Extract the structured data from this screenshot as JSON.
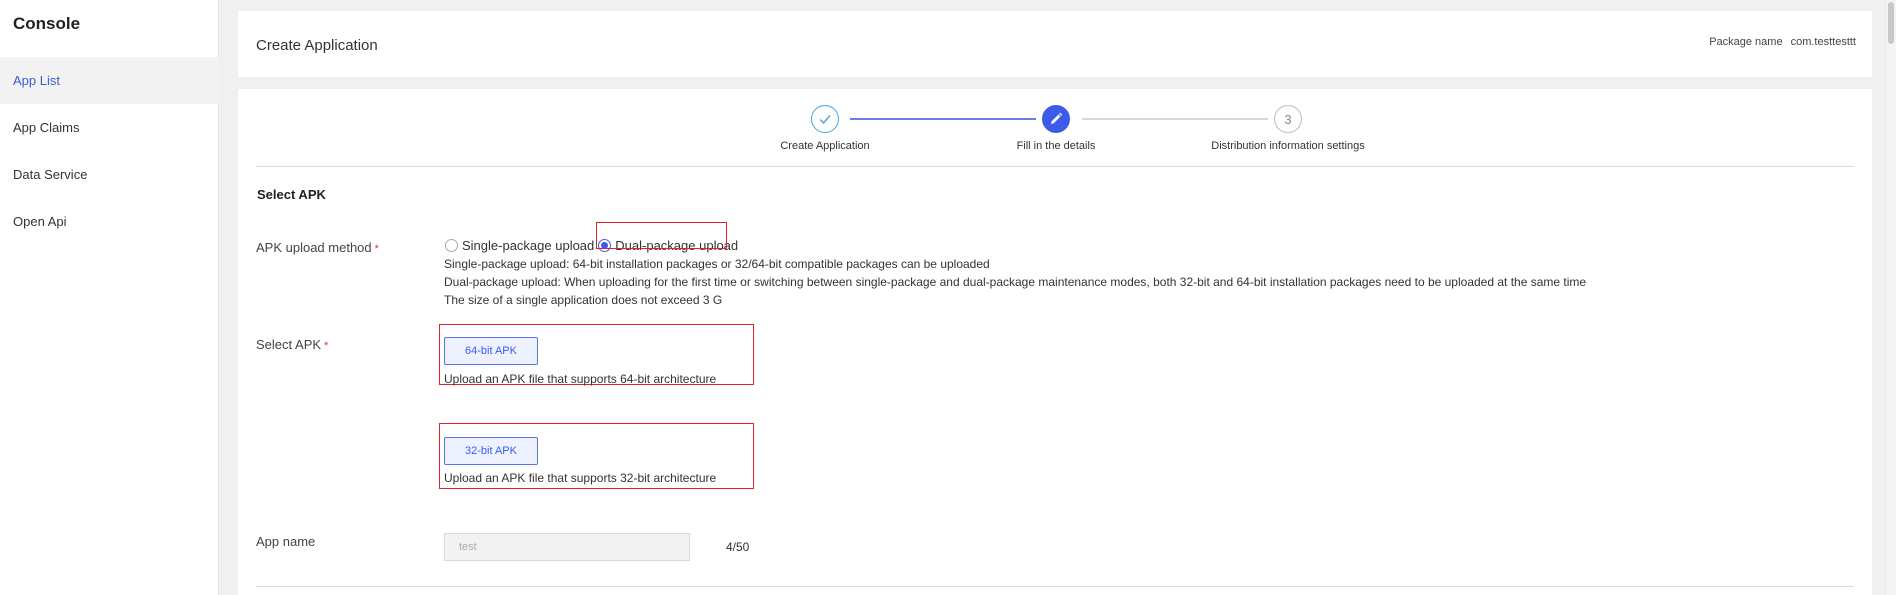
{
  "sidebar": {
    "brand": "Console",
    "items": [
      {
        "label": "App List"
      },
      {
        "label": "App Claims"
      },
      {
        "label": "Data Service"
      },
      {
        "label": "Open Api"
      }
    ]
  },
  "header": {
    "title": "Create Application",
    "package_label": "Package name",
    "package_value": "com.testtesttt"
  },
  "steps": [
    {
      "label": "Create Application",
      "state": "done"
    },
    {
      "label": "Fill in the details",
      "state": "active"
    },
    {
      "label": "Distribution information settings",
      "state": "pending",
      "number": "3"
    }
  ],
  "form": {
    "section_title": "Select APK",
    "upload_method": {
      "label": "APK upload method",
      "required_mark": "*",
      "options": [
        "Single-package upload",
        "Dual-package upload"
      ],
      "selected": "Dual-package upload"
    },
    "help_lines": [
      "Single-package upload: 64-bit installation packages or 32/64-bit compatible packages can be uploaded",
      "Dual-package upload: When uploading for the first time or switching between single-package and dual-package maintenance modes, both 32-bit and 64-bit installation packages need to be uploaded at the same time",
      "The size of a single application does not exceed 3 G"
    ],
    "select_apk": {
      "label": "Select APK",
      "required_mark": "*",
      "btn64": "64-bit APK",
      "hint64": "Upload an APK file that supports 64-bit architecture",
      "btn32": "32-bit APK",
      "hint32": "Upload an APK file that supports 32-bit architecture"
    },
    "app_name": {
      "label": "App name",
      "value": "test",
      "count": "4/50"
    }
  },
  "colors": {
    "accent": "#3b5be8",
    "highlight_box": "#e0242b",
    "required": "#e03131"
  }
}
